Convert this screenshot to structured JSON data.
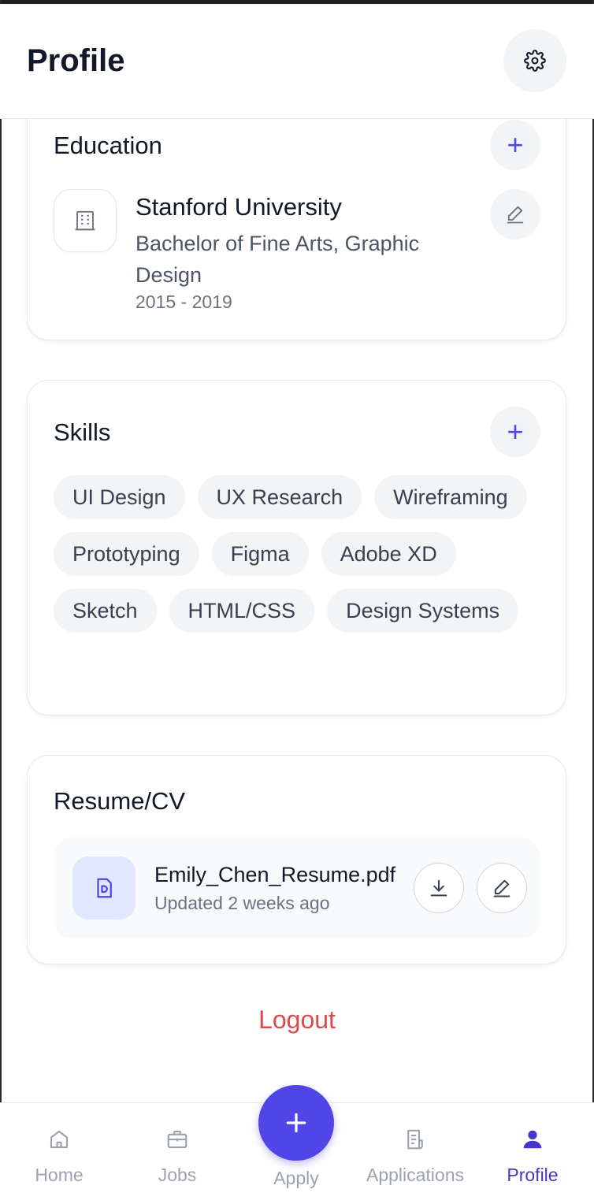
{
  "header": {
    "title": "Profile",
    "settings_icon": "gear-icon"
  },
  "education": {
    "title": "Education",
    "add_icon": "plus-icon",
    "items": [
      {
        "school": "Stanford University",
        "degree": "Bachelor of Fine Arts, Graphic Design",
        "years": "2015 - 2019",
        "logo_icon": "building-icon",
        "edit_icon": "pencil-icon"
      }
    ]
  },
  "skills": {
    "title": "Skills",
    "add_icon": "plus-icon",
    "items": [
      "UI Design",
      "UX Research",
      "Wireframing",
      "Prototyping",
      "Figma",
      "Adobe XD",
      "Sketch",
      "HTML/CSS",
      "Design Systems"
    ]
  },
  "resume": {
    "title": "Resume/CV",
    "file_name": "Emily_Chen_Resume.pdf",
    "updated": "Updated 2 weeks ago",
    "file_icon": "document-icon",
    "download_icon": "download-icon",
    "edit_icon": "pencil-icon"
  },
  "logout_label": "Logout",
  "nav": {
    "home": "Home",
    "jobs": "Jobs",
    "apply": "Apply",
    "applications": "Applications",
    "profile": "Profile",
    "active": "profile"
  },
  "colors": {
    "accent": "#4f46e5",
    "danger": "#dc4a4a",
    "chip_bg": "#f3f4f6"
  }
}
